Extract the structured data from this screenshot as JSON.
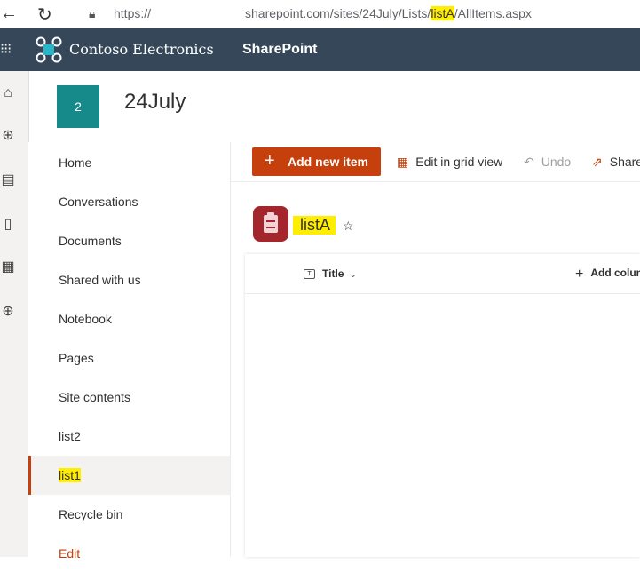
{
  "browser": {
    "url_prefix": "https://",
    "url_domain": "sharepoint.com/sites/24July/Lists/",
    "url_highlight": "listA",
    "url_suffix": "/AllItems.aspx"
  },
  "suite": {
    "org_name": "Contoso Electronics",
    "app_name": "SharePoint",
    "accent": "#36475a"
  },
  "site": {
    "logo_text": "2",
    "title": "24July"
  },
  "nav": {
    "items": [
      {
        "label": "Home"
      },
      {
        "label": "Conversations"
      },
      {
        "label": "Documents"
      },
      {
        "label": "Shared with us"
      },
      {
        "label": "Notebook"
      },
      {
        "label": "Pages"
      },
      {
        "label": "Site contents"
      },
      {
        "label": "list2"
      },
      {
        "label": "list1"
      },
      {
        "label": "Recycle bin"
      },
      {
        "label": "Edit"
      }
    ]
  },
  "commands": {
    "add_new": "Add new item",
    "grid_view": "Edit in grid view",
    "undo": "Undo",
    "share": "Share"
  },
  "list": {
    "title": "listA",
    "column_title": "Title",
    "add_column": "Add column"
  }
}
